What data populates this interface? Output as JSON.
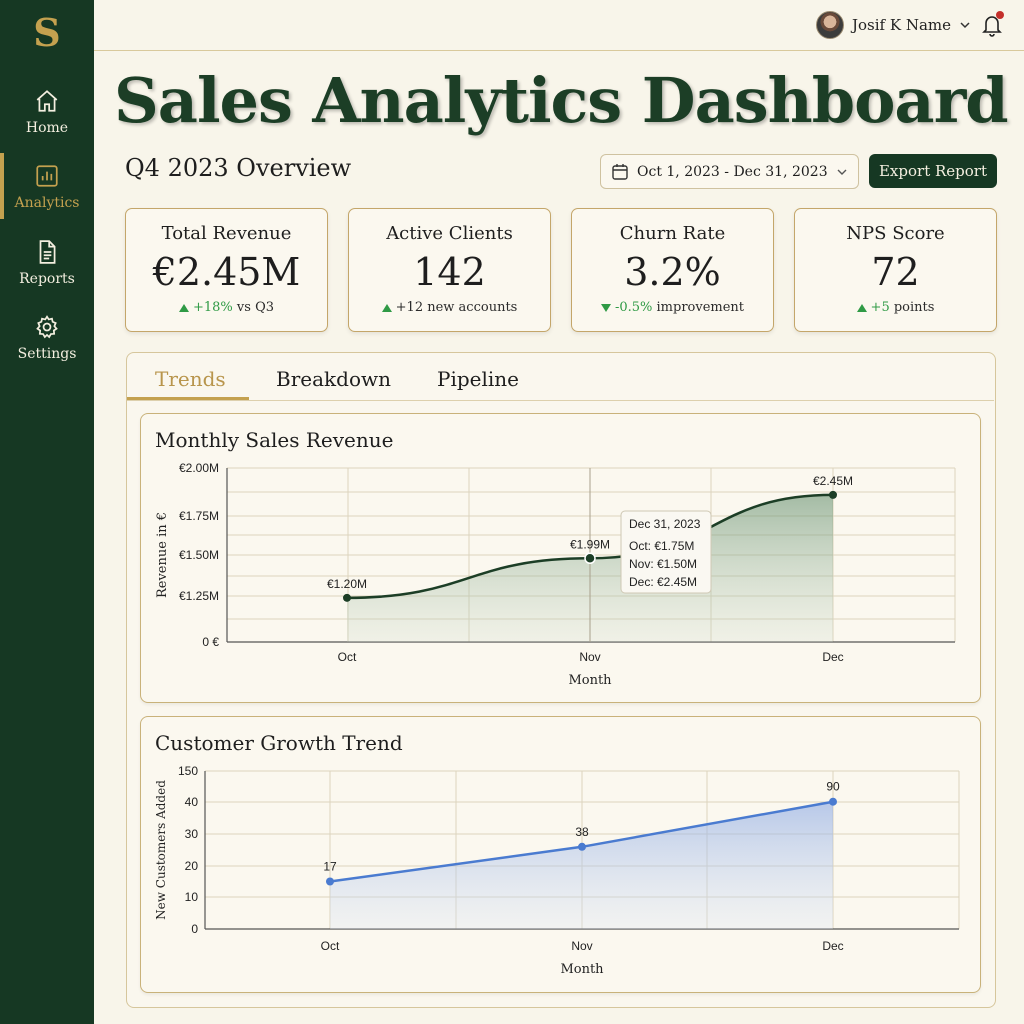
{
  "app": {
    "logo_letter": "S"
  },
  "sidebar": {
    "items": [
      {
        "label": "Home",
        "icon": "home-icon",
        "active": false
      },
      {
        "label": "Analytics",
        "icon": "bar-chart-icon",
        "active": true
      },
      {
        "label": "Reports",
        "icon": "document-icon",
        "active": false
      },
      {
        "label": "Settings",
        "icon": "gear-icon",
        "active": false
      }
    ]
  },
  "header": {
    "user_name": "Josif K Name",
    "notification_indicator": true
  },
  "page": {
    "title": "Sales Analytics Dashboard",
    "subtitle": "Q4 2023 Overview",
    "date_range": "Oct 1, 2023 - Dec 31, 2023",
    "export_label": "Export Report"
  },
  "kpis": [
    {
      "label": "Total Revenue",
      "value": "€2.45M",
      "delta_value": "+18%",
      "delta_text": "vs Q3",
      "direction": "up"
    },
    {
      "label": "Active Clients",
      "value": "142",
      "delta_value": "+12",
      "delta_text": "new accounts",
      "direction": "up"
    },
    {
      "label": "Churn Rate",
      "value": "3.2%",
      "delta_value": "-0.5%",
      "delta_text": "improvement",
      "direction": "down"
    },
    {
      "label": "NPS Score",
      "value": "72",
      "delta_value": "+5",
      "delta_text": "points",
      "direction": "up"
    }
  ],
  "tabs": [
    {
      "label": "Trends",
      "active": true
    },
    {
      "label": "Breakdown",
      "active": false
    },
    {
      "label": "Pipeline",
      "active": false
    }
  ],
  "colors": {
    "sidebar_bg": "#163823",
    "accent_gold": "#c4a14f",
    "positive_green": "#2f9a45",
    "revenue_line": "#1c3e26",
    "customers_line": "#4a7bd0"
  },
  "chart_data": [
    {
      "type": "area",
      "title": "Monthly Sales Revenue",
      "xlabel": "Month",
      "ylabel": "Revenue in €",
      "categories": [
        "Oct",
        "Nov",
        "Dec"
      ],
      "values": [
        1.2,
        1.48,
        1.86
      ],
      "data_labels": [
        "€1.20M",
        "€1.99M",
        "€2.45M"
      ],
      "y_ticks": [
        "0 €",
        "€1.25M",
        "€1.50M",
        "€1.75M",
        "€2.00M"
      ],
      "grid": true,
      "tooltip": {
        "title": "Dec 31, 2023",
        "lines": [
          "Oct: €1.75M",
          "Nov: €1.50M",
          "Dec: €2.45M"
        ]
      }
    },
    {
      "type": "area",
      "title": "Customer Growth Trend",
      "xlabel": "Month",
      "ylabel": "New Customers Added",
      "categories": [
        "Oct",
        "Nov",
        "Dec"
      ],
      "values": [
        15,
        26,
        41
      ],
      "data_labels": [
        "17",
        "38",
        "90"
      ],
      "y_ticks": [
        "0",
        "10",
        "20",
        "30",
        "40",
        "150"
      ],
      "grid": true
    }
  ]
}
